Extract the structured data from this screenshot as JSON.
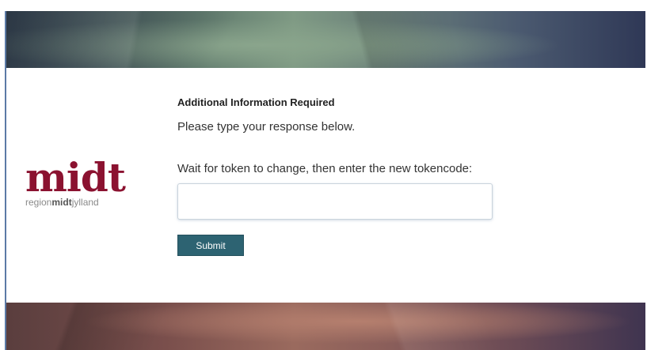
{
  "logo": {
    "wordmark": "midt",
    "sub_prefix": "region",
    "sub_bold": "midt",
    "sub_suffix": "jylland",
    "brand_color": "#8b1230"
  },
  "form": {
    "heading": "Additional Information Required",
    "instructions": "Please type your response below.",
    "prompt": "Wait for token to change, then enter the new tokencode:",
    "token_value": "",
    "token_placeholder": "",
    "submit_label": "Submit",
    "button_color": "#2d6372"
  }
}
